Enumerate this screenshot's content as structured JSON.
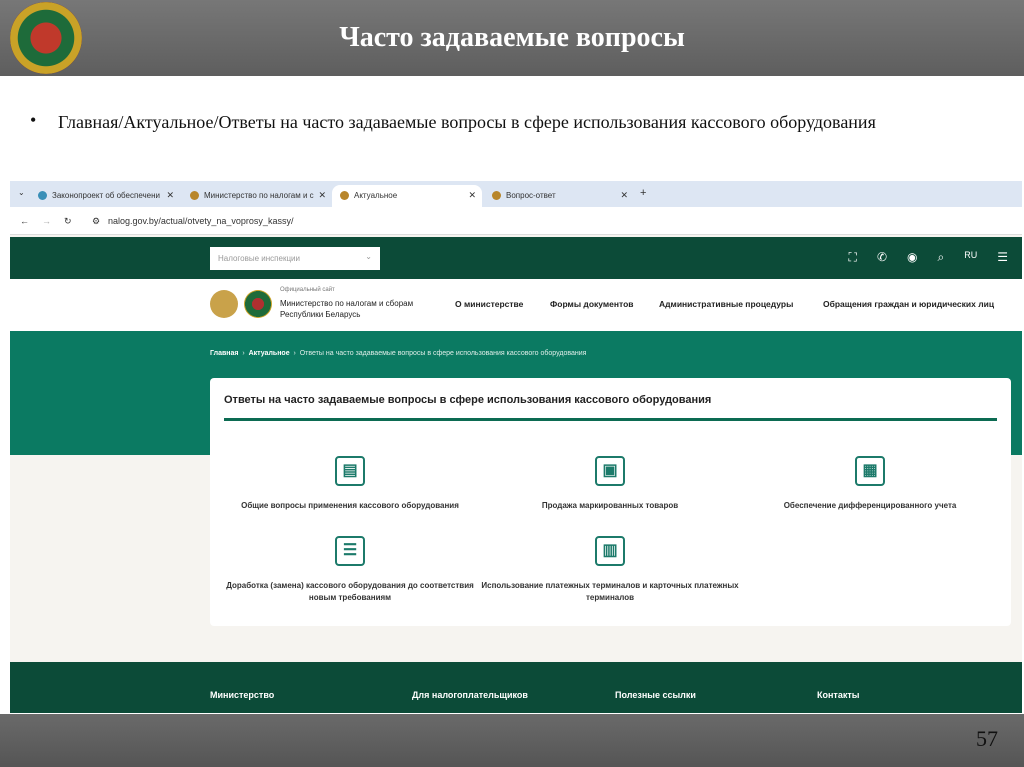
{
  "slide": {
    "title": "Часто задаваемые вопросы",
    "bullet": "•",
    "text": "Главная/Актуальное/Ответы на часто задаваемые вопросы в сфере использования кассового оборудования",
    "page": "57"
  },
  "browser": {
    "tabs": [
      "Законопроект об обеспечени",
      "Министерство по налогам и с",
      "Актуальное",
      "Вопрос-ответ"
    ],
    "url": "nalog.gov.by/actual/otvety_na_voprosy_kassy/"
  },
  "site": {
    "select_placeholder": "Налоговые инспекции",
    "lang": "RU",
    "official": "Официальный сайт",
    "ministry": "Министерство по налогам и сборам Республики Беларусь",
    "nav": [
      "О министерстве",
      "Формы документов",
      "Административные процедуры",
      "Обращения граждан и юридических лиц"
    ],
    "breadcrumbs": [
      "Главная",
      "Актуальное",
      "Ответы на часто задаваемые вопросы в сфере использования кассового оборудования"
    ],
    "card_title": "Ответы на часто задаваемые вопросы в сфере использования кассового оборудования",
    "items": [
      "Общие вопросы применения кассового оборудования",
      "Продажа маркированных товаров",
      "Обеспечение дифференцированного учета",
      "Доработка (замена) кассового оборудования до соответствия новым требованиям",
      "Использование платежных терминалов и карточных платежных терминалов"
    ],
    "footer": [
      "Министерство",
      "Для налогоплательщиков",
      "Полезные ссылки",
      "Контакты"
    ]
  }
}
